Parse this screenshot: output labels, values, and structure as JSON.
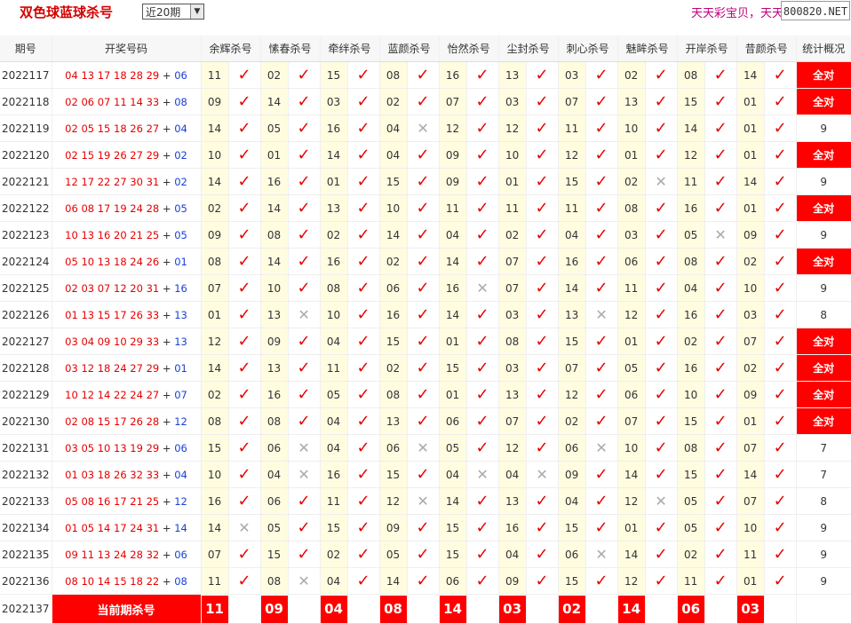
{
  "header": {
    "title": "双色球蓝球杀号",
    "select_value": "近20期",
    "marquee": "天天彩宝贝，天天",
    "domain": "800820.NET"
  },
  "columns": [
    "期号",
    "开奖号码",
    "余辉杀号",
    "愫春杀号",
    "牵绊杀号",
    "蓝颜杀号",
    "怡然杀号",
    "尘封杀号",
    "刺心杀号",
    "魅眸杀号",
    "开岸杀号",
    "昔颜杀号",
    "统计概况"
  ],
  "rows": [
    {
      "period": "2022117",
      "red": "04 13 17 18 28 29",
      "blue": "06",
      "kills": [
        [
          "11",
          true
        ],
        [
          "02",
          true
        ],
        [
          "15",
          true
        ],
        [
          "08",
          true
        ],
        [
          "16",
          true
        ],
        [
          "13",
          true
        ],
        [
          "03",
          true
        ],
        [
          "02",
          true
        ],
        [
          "08",
          true
        ],
        [
          "14",
          true
        ]
      ],
      "stat": "全对"
    },
    {
      "period": "2022118",
      "red": "02 06 07 11 14 33",
      "blue": "08",
      "kills": [
        [
          "09",
          true
        ],
        [
          "14",
          true
        ],
        [
          "03",
          true
        ],
        [
          "02",
          true
        ],
        [
          "07",
          true
        ],
        [
          "03",
          true
        ],
        [
          "07",
          true
        ],
        [
          "13",
          true
        ],
        [
          "15",
          true
        ],
        [
          "01",
          true
        ]
      ],
      "stat": "全对"
    },
    {
      "period": "2022119",
      "red": "02 05 15 18 26 27",
      "blue": "04",
      "kills": [
        [
          "14",
          true
        ],
        [
          "05",
          true
        ],
        [
          "16",
          true
        ],
        [
          "04",
          false
        ],
        [
          "12",
          true
        ],
        [
          "12",
          true
        ],
        [
          "11",
          true
        ],
        [
          "10",
          true
        ],
        [
          "14",
          true
        ],
        [
          "01",
          true
        ]
      ],
      "stat": "9"
    },
    {
      "period": "2022120",
      "red": "02 15 19 26 27 29",
      "blue": "02",
      "kills": [
        [
          "10",
          true
        ],
        [
          "01",
          true
        ],
        [
          "14",
          true
        ],
        [
          "04",
          true
        ],
        [
          "09",
          true
        ],
        [
          "10",
          true
        ],
        [
          "12",
          true
        ],
        [
          "01",
          true
        ],
        [
          "12",
          true
        ],
        [
          "01",
          true
        ]
      ],
      "stat": "全对"
    },
    {
      "period": "2022121",
      "red": "12 17 22 27 30 31",
      "blue": "02",
      "kills": [
        [
          "14",
          true
        ],
        [
          "16",
          true
        ],
        [
          "01",
          true
        ],
        [
          "15",
          true
        ],
        [
          "09",
          true
        ],
        [
          "01",
          true
        ],
        [
          "15",
          true
        ],
        [
          "02",
          false
        ],
        [
          "11",
          true
        ],
        [
          "14",
          true
        ]
      ],
      "stat": "9"
    },
    {
      "period": "2022122",
      "red": "06 08 17 19 24 28",
      "blue": "05",
      "kills": [
        [
          "02",
          true
        ],
        [
          "14",
          true
        ],
        [
          "13",
          true
        ],
        [
          "10",
          true
        ],
        [
          "11",
          true
        ],
        [
          "11",
          true
        ],
        [
          "11",
          true
        ],
        [
          "08",
          true
        ],
        [
          "16",
          true
        ],
        [
          "01",
          true
        ]
      ],
      "stat": "全对"
    },
    {
      "period": "2022123",
      "red": "10 13 16 20 21 25",
      "blue": "05",
      "kills": [
        [
          "09",
          true
        ],
        [
          "08",
          true
        ],
        [
          "02",
          true
        ],
        [
          "14",
          true
        ],
        [
          "04",
          true
        ],
        [
          "02",
          true
        ],
        [
          "04",
          true
        ],
        [
          "03",
          true
        ],
        [
          "05",
          false
        ],
        [
          "09",
          true
        ]
      ],
      "stat": "9"
    },
    {
      "period": "2022124",
      "red": "05 10 13 18 24 26",
      "blue": "01",
      "kills": [
        [
          "08",
          true
        ],
        [
          "14",
          true
        ],
        [
          "16",
          true
        ],
        [
          "02",
          true
        ],
        [
          "14",
          true
        ],
        [
          "07",
          true
        ],
        [
          "16",
          true
        ],
        [
          "06",
          true
        ],
        [
          "08",
          true
        ],
        [
          "02",
          true
        ]
      ],
      "stat": "全对"
    },
    {
      "period": "2022125",
      "red": "02 03 07 12 20 31",
      "blue": "16",
      "kills": [
        [
          "07",
          true
        ],
        [
          "10",
          true
        ],
        [
          "08",
          true
        ],
        [
          "06",
          true
        ],
        [
          "16",
          false
        ],
        [
          "07",
          true
        ],
        [
          "14",
          true
        ],
        [
          "11",
          true
        ],
        [
          "04",
          true
        ],
        [
          "10",
          true
        ]
      ],
      "stat": "9"
    },
    {
      "period": "2022126",
      "red": "01 13 15 17 26 33",
      "blue": "13",
      "kills": [
        [
          "01",
          true
        ],
        [
          "13",
          false
        ],
        [
          "10",
          true
        ],
        [
          "16",
          true
        ],
        [
          "14",
          true
        ],
        [
          "03",
          true
        ],
        [
          "13",
          false
        ],
        [
          "12",
          true
        ],
        [
          "16",
          true
        ],
        [
          "03",
          true
        ]
      ],
      "stat": "8"
    },
    {
      "period": "2022127",
      "red": "03 04 09 10 29 33",
      "blue": "13",
      "kills": [
        [
          "12",
          true
        ],
        [
          "09",
          true
        ],
        [
          "04",
          true
        ],
        [
          "15",
          true
        ],
        [
          "01",
          true
        ],
        [
          "08",
          true
        ],
        [
          "15",
          true
        ],
        [
          "01",
          true
        ],
        [
          "02",
          true
        ],
        [
          "07",
          true
        ]
      ],
      "stat": "全对"
    },
    {
      "period": "2022128",
      "red": "03 12 18 24 27 29",
      "blue": "01",
      "kills": [
        [
          "14",
          true
        ],
        [
          "13",
          true
        ],
        [
          "11",
          true
        ],
        [
          "02",
          true
        ],
        [
          "15",
          true
        ],
        [
          "03",
          true
        ],
        [
          "07",
          true
        ],
        [
          "05",
          true
        ],
        [
          "16",
          true
        ],
        [
          "02",
          true
        ]
      ],
      "stat": "全对"
    },
    {
      "period": "2022129",
      "red": "10 12 14 22 24 27",
      "blue": "07",
      "kills": [
        [
          "02",
          true
        ],
        [
          "16",
          true
        ],
        [
          "05",
          true
        ],
        [
          "08",
          true
        ],
        [
          "01",
          true
        ],
        [
          "13",
          true
        ],
        [
          "12",
          true
        ],
        [
          "06",
          true
        ],
        [
          "10",
          true
        ],
        [
          "09",
          true
        ]
      ],
      "stat": "全对"
    },
    {
      "period": "2022130",
      "red": "02 08 15 17 26 28",
      "blue": "12",
      "kills": [
        [
          "08",
          true
        ],
        [
          "08",
          true
        ],
        [
          "04",
          true
        ],
        [
          "13",
          true
        ],
        [
          "06",
          true
        ],
        [
          "07",
          true
        ],
        [
          "02",
          true
        ],
        [
          "07",
          true
        ],
        [
          "15",
          true
        ],
        [
          "01",
          true
        ]
      ],
      "stat": "全对"
    },
    {
      "period": "2022131",
      "red": "03 05 10 13 19 29",
      "blue": "06",
      "kills": [
        [
          "15",
          true
        ],
        [
          "06",
          false
        ],
        [
          "04",
          true
        ],
        [
          "06",
          false
        ],
        [
          "05",
          true
        ],
        [
          "12",
          true
        ],
        [
          "06",
          false
        ],
        [
          "10",
          true
        ],
        [
          "08",
          true
        ],
        [
          "07",
          true
        ]
      ],
      "stat": "7"
    },
    {
      "period": "2022132",
      "red": "01 03 18 26 32 33",
      "blue": "04",
      "kills": [
        [
          "10",
          true
        ],
        [
          "04",
          false
        ],
        [
          "16",
          true
        ],
        [
          "15",
          true
        ],
        [
          "04",
          false
        ],
        [
          "04",
          false
        ],
        [
          "09",
          true
        ],
        [
          "14",
          true
        ],
        [
          "15",
          true
        ],
        [
          "14",
          true
        ]
      ],
      "stat": "7"
    },
    {
      "period": "2022133",
      "red": "05 08 16 17 21 25",
      "blue": "12",
      "kills": [
        [
          "16",
          true
        ],
        [
          "06",
          true
        ],
        [
          "11",
          true
        ],
        [
          "12",
          false
        ],
        [
          "14",
          true
        ],
        [
          "13",
          true
        ],
        [
          "04",
          true
        ],
        [
          "12",
          false
        ],
        [
          "05",
          true
        ],
        [
          "07",
          true
        ]
      ],
      "stat": "8"
    },
    {
      "period": "2022134",
      "red": "01 05 14 17 24 31",
      "blue": "14",
      "kills": [
        [
          "14",
          false
        ],
        [
          "05",
          true
        ],
        [
          "15",
          true
        ],
        [
          "09",
          true
        ],
        [
          "15",
          true
        ],
        [
          "16",
          true
        ],
        [
          "15",
          true
        ],
        [
          "01",
          true
        ],
        [
          "05",
          true
        ],
        [
          "10",
          true
        ]
      ],
      "stat": "9"
    },
    {
      "period": "2022135",
      "red": "09 11 13 24 28 32",
      "blue": "06",
      "kills": [
        [
          "07",
          true
        ],
        [
          "15",
          true
        ],
        [
          "02",
          true
        ],
        [
          "05",
          true
        ],
        [
          "15",
          true
        ],
        [
          "04",
          true
        ],
        [
          "06",
          false
        ],
        [
          "14",
          true
        ],
        [
          "02",
          true
        ],
        [
          "11",
          true
        ]
      ],
      "stat": "9"
    },
    {
      "period": "2022136",
      "red": "08 10 14 15 18 22",
      "blue": "08",
      "kills": [
        [
          "11",
          true
        ],
        [
          "08",
          false
        ],
        [
          "04",
          true
        ],
        [
          "14",
          true
        ],
        [
          "06",
          true
        ],
        [
          "09",
          true
        ],
        [
          "15",
          true
        ],
        [
          "12",
          true
        ],
        [
          "11",
          true
        ],
        [
          "01",
          true
        ]
      ],
      "stat": "9"
    }
  ],
  "current": {
    "period": "2022137",
    "label": "当前期杀号",
    "kills": [
      "11",
      "09",
      "04",
      "08",
      "14",
      "03",
      "02",
      "14",
      "06",
      "03"
    ]
  },
  "marks": {
    "hit": "✓",
    "miss": "✕"
  },
  "colors": {
    "red": "#e60000",
    "blue": "#1a3fd6",
    "highlight": "#ff0000",
    "cell_bg": "#fffce0"
  }
}
